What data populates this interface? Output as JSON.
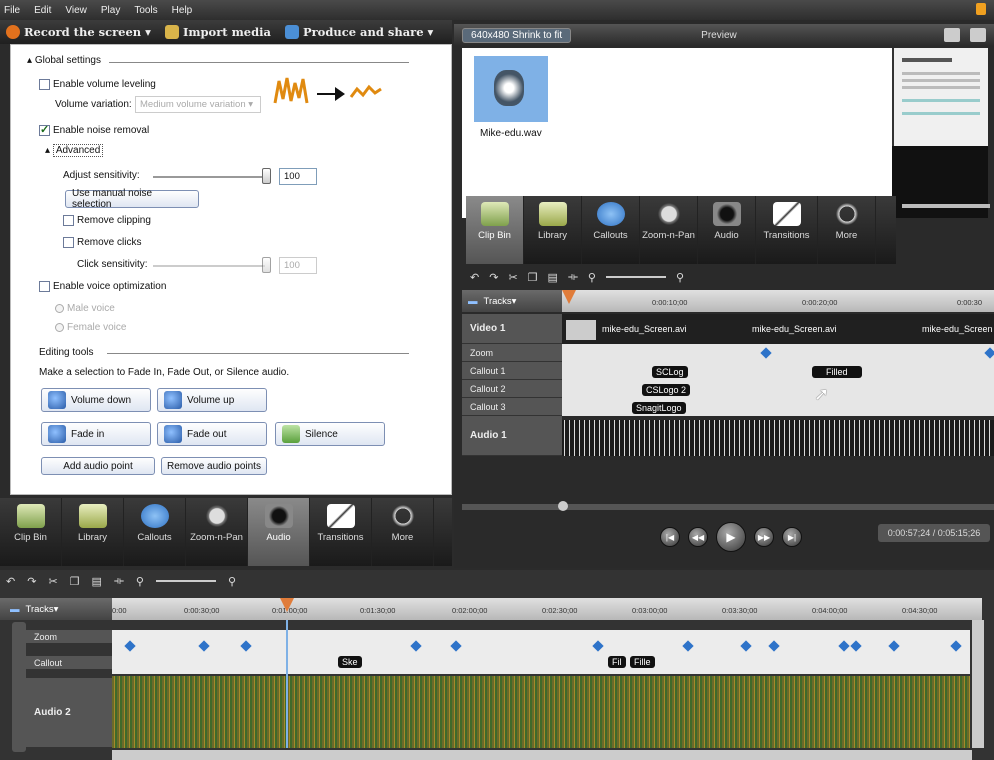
{
  "menu": [
    "File",
    "Edit",
    "View",
    "Play",
    "Tools",
    "Help"
  ],
  "toolbar": {
    "record": "Record the screen ▾",
    "import": "Import media",
    "produce": "Produce and share ▾"
  },
  "left": {
    "global": "Global settings",
    "volume_leveling": "Enable volume leveling",
    "volume_variation_label": "Volume variation:",
    "volume_variation_value": "Medium volume variation",
    "noise_removal": "Enable noise removal",
    "advanced": "Advanced",
    "adjust_sensitivity": "Adjust sensitivity:",
    "sensitivity_value": "100",
    "manual_noise": "Use manual noise selection",
    "remove_clipping": "Remove clipping",
    "remove_clicks": "Remove clicks",
    "click_sensitivity": "Click sensitivity:",
    "click_value": "100",
    "voice_opt": "Enable voice optimization",
    "male": "Male voice",
    "female": "Female voice",
    "editing_tools": "Editing tools",
    "instructions": "Make a selection to Fade In, Fade Out, or Silence audio.",
    "volume_down": "Volume down",
    "volume_up": "Volume up",
    "fade_in": "Fade in",
    "fade_out": "Fade out",
    "silence": "Silence",
    "add_point": "Add audio point",
    "remove_points": "Remove audio points"
  },
  "lefttabs": [
    {
      "label": "Clip Bin",
      "icon": "clip-bin-icon"
    },
    {
      "label": "Library",
      "icon": "library-icon"
    },
    {
      "label": "Callouts",
      "icon": "callouts-icon"
    },
    {
      "label": "Zoom-n-Pan",
      "icon": "zoom-icon"
    },
    {
      "label": "Audio",
      "icon": "audio-icon"
    },
    {
      "label": "Transitions",
      "icon": "transitions-icon"
    },
    {
      "label": "More",
      "icon": "more-icon"
    }
  ],
  "right": {
    "dimensions": "640x480 Shrink to fit",
    "preview": "Preview",
    "clip_name": "Mike-edu.wav",
    "tabs": [
      {
        "label": "Clip Bin"
      },
      {
        "label": "Library"
      },
      {
        "label": "Callouts"
      },
      {
        "label": "Zoom-n-Pan"
      },
      {
        "label": "Audio"
      },
      {
        "label": "Transitions"
      },
      {
        "label": "More"
      }
    ],
    "tracks_label": "Tracks",
    "ticks": [
      "0:00:10;00",
      "0:00:20;00",
      "0:00:30"
    ],
    "video1": "Video 1",
    "zoom": "Zoom",
    "callout1": "Callout 1",
    "callout2": "Callout 2",
    "callout3": "Callout 3",
    "audio1": "Audio 1",
    "clip1": "mike-edu_Screen.avi",
    "clip2": "mike-edu_Screen.avi",
    "clip3": "mike-edu_Screen",
    "callouts": [
      "SCLog",
      "CSLogo 2",
      "SnagitLogo",
      "Filled"
    ],
    "time": "0:00:57;24 / 0:05:15;26"
  },
  "bottom": {
    "tracks_label": "Tracks",
    "ticks": [
      "0:00",
      "0:00:30;00",
      "0:01:00;00",
      "0:01:30;00",
      "0:02:00;00",
      "0:02:30;00",
      "0:03:00;00",
      "0:03:30;00",
      "0:04:00;00",
      "0:04:30;00"
    ],
    "zoom": "Zoom",
    "callout": "Callout",
    "audio2": "Audio 2",
    "callouts": [
      "Ske",
      "Fil",
      "Fille"
    ]
  }
}
